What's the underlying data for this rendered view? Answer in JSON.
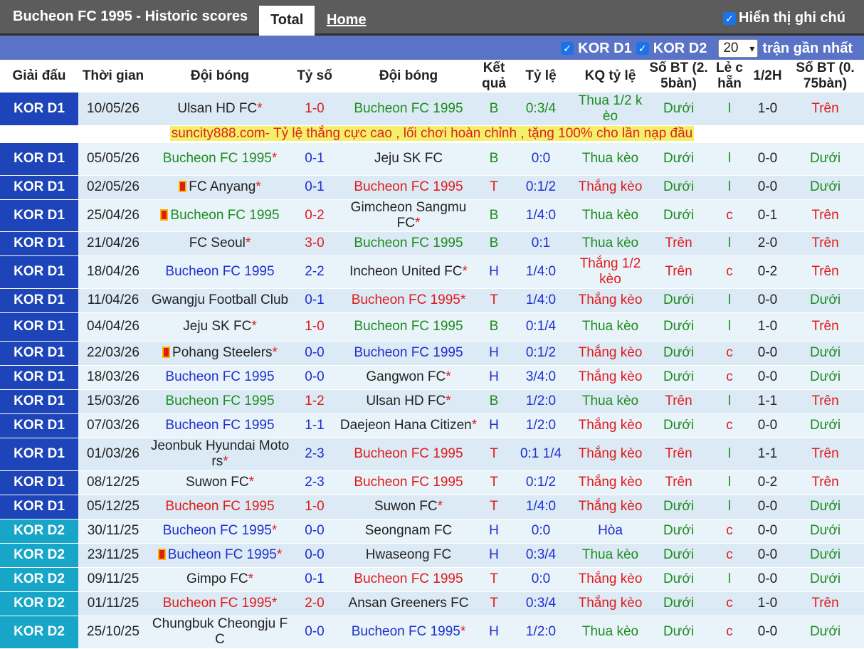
{
  "header": {
    "title": "Bucheon FC 1995 - Historic scores",
    "tabs": [
      "Total",
      "Home"
    ],
    "toggle_label": "Hiển thị ghi chú"
  },
  "filters": {
    "league_1": "KOR D1",
    "league_2": "KOR D2",
    "count_value": "20",
    "count_label": "trận gần nhất"
  },
  "columns": [
    "Giải đấu",
    "Thời gian",
    "Đội bóng",
    "Tỷ số",
    "Đội bóng",
    "Kết quả",
    "Tỷ lệ",
    "KQ tỷ lệ",
    "Số BT (2. 5bàn)",
    "Lẻ c hẵn",
    "1/2H",
    "Số BT (0. 75bàn)"
  ],
  "ad": "suncity888.com- Tỷ lệ thắng cực cao , lối chơi hoàn chỉnh , tặng 100% cho lần nạp đầu",
  "colors": {
    "red": "#e01b1b",
    "green": "#1e8c1e",
    "blue": "#1e2fd0",
    "d1": "#1d44b8",
    "d2": "#17a6c7"
  },
  "rows": [
    {
      "league": "KOR D1",
      "date": "10/05/26",
      "home": "Ulsan HD FC",
      "home_star": true,
      "home_flag": false,
      "home_color": "default",
      "score": "1-0",
      "score_color": "red",
      "away": "Bucheon FC 1995",
      "away_star": false,
      "away_color": "green",
      "result": "B",
      "result_color": "green",
      "odds": "0:3/4",
      "odds_color": "green",
      "odds_result": "Thua 1/2 k èo",
      "odds_result_color": "green",
      "ou": "Dưới",
      "ou_color": "green",
      "oe": "l",
      "oe_color": "green",
      "ht": "1-0",
      "ou2": "Trên",
      "ou2_color": "red"
    },
    {
      "league": "KOR D1",
      "date": "05/05/26",
      "home": "Bucheon FC 1995",
      "home_star": true,
      "home_flag": false,
      "home_color": "green",
      "score": "0-1",
      "score_color": "blue",
      "away": "Jeju SK FC",
      "away_star": false,
      "away_color": "default",
      "result": "B",
      "result_color": "green",
      "odds": "0:0",
      "odds_color": "blue",
      "odds_result": "Thua kèo",
      "odds_result_color": "green",
      "ou": "Dưới",
      "ou_color": "green",
      "oe": "l",
      "oe_color": "green",
      "ht": "0-0",
      "ou2": "Dưới",
      "ou2_color": "green"
    },
    {
      "league": "KOR D1",
      "date": "02/05/26",
      "home": "FC Anyang",
      "home_star": true,
      "home_flag": true,
      "home_color": "default",
      "score": "0-1",
      "score_color": "blue",
      "away": "Bucheon FC 1995",
      "away_star": false,
      "away_color": "red",
      "result": "T",
      "result_color": "red",
      "odds": "0:1/2",
      "odds_color": "blue",
      "odds_result": "Thắng kèo",
      "odds_result_color": "red",
      "ou": "Dưới",
      "ou_color": "green",
      "oe": "l",
      "oe_color": "green",
      "ht": "0-0",
      "ou2": "Dưới",
      "ou2_color": "green"
    },
    {
      "league": "KOR D1",
      "date": "25/04/26",
      "home": "Bucheon FC 1995",
      "home_star": false,
      "home_flag": true,
      "home_color": "green",
      "score": "0-2",
      "score_color": "red",
      "away": "Gimcheon Sangmu FC",
      "away_star": true,
      "away_color": "default",
      "result": "B",
      "result_color": "green",
      "odds": "1/4:0",
      "odds_color": "blue",
      "odds_result": "Thua kèo",
      "odds_result_color": "green",
      "ou": "Dưới",
      "ou_color": "green",
      "oe": "c",
      "oe_color": "red",
      "ht": "0-1",
      "ou2": "Trên",
      "ou2_color": "red"
    },
    {
      "league": "KOR D1",
      "date": "21/04/26",
      "home": "FC Seoul",
      "home_star": true,
      "home_flag": false,
      "home_color": "default",
      "score": "3-0",
      "score_color": "red",
      "away": "Bucheon FC 1995",
      "away_star": false,
      "away_color": "green",
      "result": "B",
      "result_color": "green",
      "odds": "0:1",
      "odds_color": "blue",
      "odds_result": "Thua kèo",
      "odds_result_color": "green",
      "ou": "Trên",
      "ou_color": "red",
      "oe": "l",
      "oe_color": "green",
      "ht": "2-0",
      "ou2": "Trên",
      "ou2_color": "red"
    },
    {
      "league": "KOR D1",
      "date": "18/04/26",
      "home": "Bucheon FC 1995",
      "home_star": false,
      "home_flag": false,
      "home_color": "blue",
      "score": "2-2",
      "score_color": "blue",
      "away": "Incheon United FC",
      "away_star": true,
      "away_color": "default",
      "result": "H",
      "result_color": "blue",
      "odds": "1/4:0",
      "odds_color": "blue",
      "odds_result": "Thắng 1/2 kèo",
      "odds_result_color": "red",
      "ou": "Trên",
      "ou_color": "red",
      "oe": "c",
      "oe_color": "red",
      "ht": "0-2",
      "ou2": "Trên",
      "ou2_color": "red"
    },
    {
      "league": "KOR D1",
      "date": "11/04/26",
      "home": "Gwangju Football Club",
      "home_star": false,
      "home_flag": false,
      "home_color": "default",
      "score": "0-1",
      "score_color": "blue",
      "away": "Bucheon FC 1995",
      "away_star": true,
      "away_color": "red",
      "result": "T",
      "result_color": "red",
      "odds": "1/4:0",
      "odds_color": "blue",
      "odds_result": "Thắng kèo",
      "odds_result_color": "red",
      "ou": "Dưới",
      "ou_color": "green",
      "oe": "l",
      "oe_color": "green",
      "ht": "0-0",
      "ou2": "Dưới",
      "ou2_color": "green"
    },
    {
      "league": "KOR D1",
      "date": "04/04/26",
      "home": "Jeju SK FC",
      "home_star": true,
      "home_flag": false,
      "home_color": "default",
      "score": "1-0",
      "score_color": "red",
      "away": "Bucheon FC 1995",
      "away_star": false,
      "away_color": "green",
      "result": "B",
      "result_color": "green",
      "odds": "0:1/4",
      "odds_color": "blue",
      "odds_result": "Thua kèo",
      "odds_result_color": "green",
      "ou": "Dưới",
      "ou_color": "green",
      "oe": "l",
      "oe_color": "green",
      "ht": "1-0",
      "ou2": "Trên",
      "ou2_color": "red"
    },
    {
      "league": "KOR D1",
      "date": "22/03/26",
      "home": "Pohang Steelers",
      "home_star": true,
      "home_flag": true,
      "home_color": "default",
      "score": "0-0",
      "score_color": "blue",
      "away": "Bucheon FC 1995",
      "away_star": false,
      "away_color": "blue",
      "result": "H",
      "result_color": "blue",
      "odds": "0:1/2",
      "odds_color": "blue",
      "odds_result": "Thắng kèo",
      "odds_result_color": "red",
      "ou": "Dưới",
      "ou_color": "green",
      "oe": "c",
      "oe_color": "red",
      "ht": "0-0",
      "ou2": "Dưới",
      "ou2_color": "green"
    },
    {
      "league": "KOR D1",
      "date": "18/03/26",
      "home": "Bucheon FC 1995",
      "home_star": false,
      "home_flag": false,
      "home_color": "blue",
      "score": "0-0",
      "score_color": "blue",
      "away": "Gangwon FC",
      "away_star": true,
      "away_color": "default",
      "result": "H",
      "result_color": "blue",
      "odds": "3/4:0",
      "odds_color": "blue",
      "odds_result": "Thắng kèo",
      "odds_result_color": "red",
      "ou": "Dưới",
      "ou_color": "green",
      "oe": "c",
      "oe_color": "red",
      "ht": "0-0",
      "ou2": "Dưới",
      "ou2_color": "green"
    },
    {
      "league": "KOR D1",
      "date": "15/03/26",
      "home": "Bucheon FC 1995",
      "home_star": false,
      "home_flag": false,
      "home_color": "green",
      "score": "1-2",
      "score_color": "red",
      "away": "Ulsan HD FC",
      "away_star": true,
      "away_color": "default",
      "result": "B",
      "result_color": "green",
      "odds": "1/2:0",
      "odds_color": "blue",
      "odds_result": "Thua kèo",
      "odds_result_color": "green",
      "ou": "Trên",
      "ou_color": "red",
      "oe": "l",
      "oe_color": "green",
      "ht": "1-1",
      "ou2": "Trên",
      "ou2_color": "red"
    },
    {
      "league": "KOR D1",
      "date": "07/03/26",
      "home": "Bucheon FC 1995",
      "home_star": false,
      "home_flag": false,
      "home_color": "blue",
      "score": "1-1",
      "score_color": "blue",
      "away": "Daejeon Hana Citizen",
      "away_star": true,
      "away_color": "default",
      "result": "H",
      "result_color": "blue",
      "odds": "1/2:0",
      "odds_color": "blue",
      "odds_result": "Thắng kèo",
      "odds_result_color": "red",
      "ou": "Dưới",
      "ou_color": "green",
      "oe": "c",
      "oe_color": "red",
      "ht": "0-0",
      "ou2": "Dưới",
      "ou2_color": "green"
    },
    {
      "league": "KOR D1",
      "date": "01/03/26",
      "home": "Jeonbuk Hyundai Moto rs",
      "home_star": true,
      "home_flag": false,
      "home_color": "default",
      "score": "2-3",
      "score_color": "blue",
      "away": "Bucheon FC 1995",
      "away_star": false,
      "away_color": "red",
      "result": "T",
      "result_color": "red",
      "odds": "0:1 1/4",
      "odds_color": "blue",
      "odds_result": "Thắng kèo",
      "odds_result_color": "red",
      "ou": "Trên",
      "ou_color": "red",
      "oe": "l",
      "oe_color": "green",
      "ht": "1-1",
      "ou2": "Trên",
      "ou2_color": "red"
    },
    {
      "league": "KOR D1",
      "date": "08/12/25",
      "home": "Suwon FC",
      "home_star": true,
      "home_flag": false,
      "home_color": "default",
      "score": "2-3",
      "score_color": "blue",
      "away": "Bucheon FC 1995",
      "away_star": false,
      "away_color": "red",
      "result": "T",
      "result_color": "red",
      "odds": "0:1/2",
      "odds_color": "blue",
      "odds_result": "Thắng kèo",
      "odds_result_color": "red",
      "ou": "Trên",
      "ou_color": "red",
      "oe": "l",
      "oe_color": "green",
      "ht": "0-2",
      "ou2": "Trên",
      "ou2_color": "red"
    },
    {
      "league": "KOR D1",
      "date": "05/12/25",
      "home": "Bucheon FC 1995",
      "home_star": false,
      "home_flag": false,
      "home_color": "red",
      "score": "1-0",
      "score_color": "red",
      "away": "Suwon FC",
      "away_star": true,
      "away_color": "default",
      "result": "T",
      "result_color": "red",
      "odds": "1/4:0",
      "odds_color": "blue",
      "odds_result": "Thắng kèo",
      "odds_result_color": "red",
      "ou": "Dưới",
      "ou_color": "green",
      "oe": "l",
      "oe_color": "green",
      "ht": "0-0",
      "ou2": "Dưới",
      "ou2_color": "green"
    },
    {
      "league": "KOR D2",
      "date": "30/11/25",
      "home": "Bucheon FC 1995",
      "home_star": true,
      "home_flag": false,
      "home_color": "blue",
      "score": "0-0",
      "score_color": "blue",
      "away": "Seongnam FC",
      "away_star": false,
      "away_color": "default",
      "result": "H",
      "result_color": "blue",
      "odds": "0:0",
      "odds_color": "blue",
      "odds_result": "Hòa",
      "odds_result_color": "blue",
      "ou": "Dưới",
      "ou_color": "green",
      "oe": "c",
      "oe_color": "red",
      "ht": "0-0",
      "ou2": "Dưới",
      "ou2_color": "green"
    },
    {
      "league": "KOR D2",
      "date": "23/11/25",
      "home": "Bucheon FC 1995",
      "home_star": true,
      "home_flag": true,
      "home_color": "blue",
      "score": "0-0",
      "score_color": "blue",
      "away": "Hwaseong FC",
      "away_star": false,
      "away_color": "default",
      "result": "H",
      "result_color": "blue",
      "odds": "0:3/4",
      "odds_color": "blue",
      "odds_result": "Thua kèo",
      "odds_result_color": "green",
      "ou": "Dưới",
      "ou_color": "green",
      "oe": "c",
      "oe_color": "red",
      "ht": "0-0",
      "ou2": "Dưới",
      "ou2_color": "green"
    },
    {
      "league": "KOR D2",
      "date": "09/11/25",
      "home": "Gimpo FC",
      "home_star": true,
      "home_flag": false,
      "home_color": "default",
      "score": "0-1",
      "score_color": "blue",
      "away": "Bucheon FC 1995",
      "away_star": false,
      "away_color": "red",
      "result": "T",
      "result_color": "red",
      "odds": "0:0",
      "odds_color": "blue",
      "odds_result": "Thắng kèo",
      "odds_result_color": "red",
      "ou": "Dưới",
      "ou_color": "green",
      "oe": "l",
      "oe_color": "green",
      "ht": "0-0",
      "ou2": "Dưới",
      "ou2_color": "green"
    },
    {
      "league": "KOR D2",
      "date": "01/11/25",
      "home": "Bucheon FC 1995",
      "home_star": true,
      "home_flag": false,
      "home_color": "red",
      "score": "2-0",
      "score_color": "red",
      "away": "Ansan Greeners FC",
      "away_star": false,
      "away_color": "default",
      "result": "T",
      "result_color": "red",
      "odds": "0:3/4",
      "odds_color": "blue",
      "odds_result": "Thắng kèo",
      "odds_result_color": "red",
      "ou": "Dưới",
      "ou_color": "green",
      "oe": "c",
      "oe_color": "red",
      "ht": "1-0",
      "ou2": "Trên",
      "ou2_color": "red"
    },
    {
      "league": "KOR D2",
      "date": "25/10/25",
      "home": "Chungbuk Cheongju F C",
      "home_star": false,
      "home_flag": false,
      "home_color": "default",
      "score": "0-0",
      "score_color": "blue",
      "away": "Bucheon FC 1995",
      "away_star": true,
      "away_color": "blue",
      "result": "H",
      "result_color": "blue",
      "odds": "1/2:0",
      "odds_color": "blue",
      "odds_result": "Thua kèo",
      "odds_result_color": "green",
      "ou": "Dưới",
      "ou_color": "green",
      "oe": "c",
      "oe_color": "red",
      "ht": "0-0",
      "ou2": "Dưới",
      "ou2_color": "green"
    }
  ]
}
